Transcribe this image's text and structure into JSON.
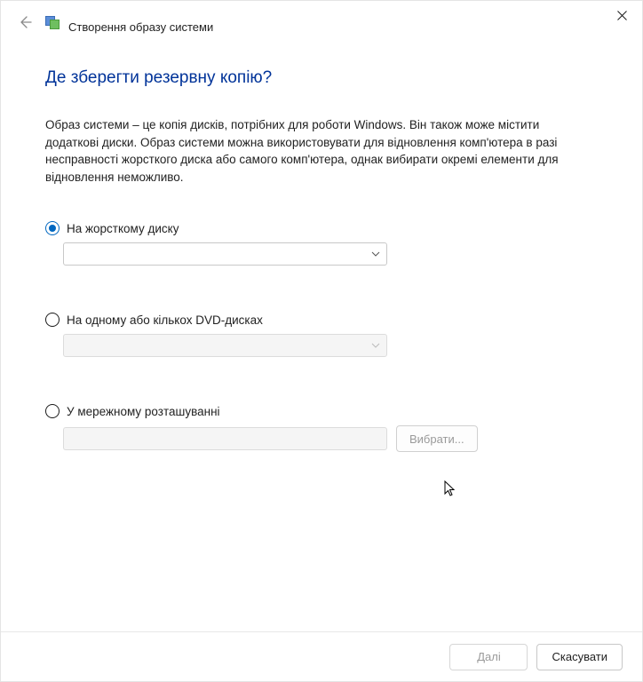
{
  "window": {
    "title": "Створення образу системи"
  },
  "heading": "Де зберегти резервну копію?",
  "description": "Образ системи – це копія дисків, потрібних для роботи Windows. Він також може містити додаткові диски. Образ системи можна використовувати для відновлення комп'ютера в разі несправності жорсткого диска або самого комп'ютера, однак вибирати окремі елементи для відновлення неможливо.",
  "options": {
    "hard_disk": {
      "label": "На жорсткому диску",
      "value": ""
    },
    "dvd": {
      "label": "На одному або кількох DVD-дисках",
      "value": ""
    },
    "network": {
      "label": "У мережному розташуванні",
      "value": "",
      "browse_label": "Вибрати..."
    }
  },
  "footer": {
    "next": "Далі",
    "cancel": "Скасувати"
  }
}
